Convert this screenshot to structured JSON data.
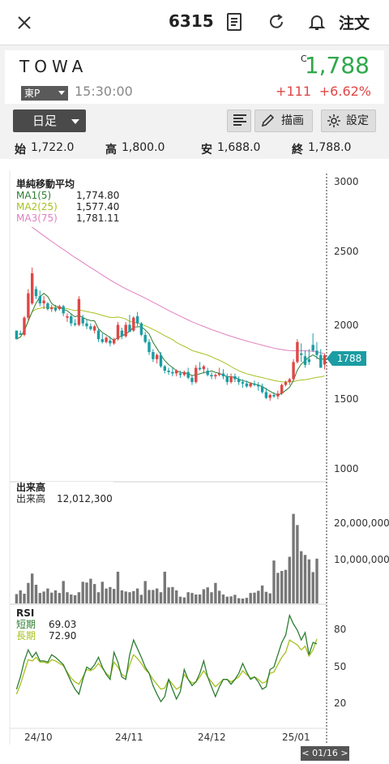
{
  "header": {
    "code": "6315",
    "order_label": "注文",
    "icons": [
      "close-icon",
      "memo-icon",
      "refresh-icon",
      "bell-icon"
    ]
  },
  "stock": {
    "name": "TOWA",
    "exchange": "東P",
    "time": "15:30:00",
    "c_flag": "C",
    "price": "1,788",
    "change": "+111",
    "change_pct": "+6.62%",
    "price_color": "#2ea84a",
    "change_color": "#e04646"
  },
  "controls": {
    "period": "日足",
    "draw_label": "描画",
    "settings_label": "設定"
  },
  "ohlc": {
    "open_label": "始",
    "open": "1,722.0",
    "high_label": "高",
    "high": "1,800.0",
    "low_label": "安",
    "low": "1,688.0",
    "close_label": "終",
    "close": "1,788.0"
  },
  "main_chart": {
    "title": "単純移動平均",
    "ma1_label": "MA1(5)",
    "ma1_value": "1,774.80",
    "ma1_color": "#2e7d32",
    "ma2_label": "MA2(25)",
    "ma2_value": "1,577.40",
    "ma2_color": "#a8c020",
    "ma3_label": "MA3(75)",
    "ma3_value": "1,781.11",
    "ma3_color": "#e080c0",
    "y_ticks": [
      "3000",
      "2500",
      "2000",
      "1500",
      "1000"
    ],
    "price_tag": "1788"
  },
  "volume_chart": {
    "title": "出来高",
    "label": "出来高",
    "value": "12,012,300",
    "y_ticks": [
      "20,000,000",
      "10,000,000"
    ]
  },
  "rsi_chart": {
    "title": "RSI",
    "short_label": "短期",
    "short_value": "69.03",
    "short_color": "#2e7d32",
    "long_label": "長期",
    "long_value": "72.90",
    "long_color": "#a8c020",
    "y_ticks": [
      "80",
      "50",
      "20"
    ]
  },
  "x_axis": {
    "labels": [
      "24/10",
      "24/11",
      "24/12",
      "25/01"
    ],
    "cursor_date": "< 01/16 >"
  },
  "chart_data": {
    "type": "candlestick",
    "up_color": "#e04646",
    "down_color": "#1a9da3",
    "ylim": [
      1000,
      3000
    ],
    "candles": [
      [
        1960,
        1960,
        1920,
        1900
      ],
      [
        1940,
        1960,
        1930,
        1930
      ],
      [
        1930,
        2060,
        1920,
        2050
      ],
      [
        2050,
        2250,
        2030,
        2220
      ],
      [
        2150,
        2400,
        2140,
        2360
      ],
      [
        2250,
        2270,
        2180,
        2200
      ],
      [
        2200,
        2240,
        2130,
        2150
      ],
      [
        2150,
        2200,
        2110,
        2170
      ],
      [
        2150,
        2160,
        2100,
        2110
      ],
      [
        2110,
        2140,
        2090,
        2120
      ],
      [
        2120,
        2140,
        2090,
        2100
      ],
      [
        2110,
        2140,
        2100,
        2130
      ],
      [
        2130,
        2140,
        2060,
        2080
      ],
      [
        2050,
        2080,
        2020,
        2060
      ],
      [
        2060,
        2080,
        1990,
        2010
      ],
      [
        2010,
        2040,
        1990,
        2000
      ],
      [
        2000,
        2200,
        1990,
        2180
      ],
      [
        2050,
        2070,
        1990,
        2010
      ],
      [
        2010,
        2040,
        1970,
        1990
      ],
      [
        1990,
        2010,
        1960,
        1970
      ],
      [
        1960,
        2000,
        1940,
        1990
      ],
      [
        1960,
        1970,
        1880,
        1900
      ],
      [
        1900,
        1940,
        1870,
        1880
      ],
      [
        1880,
        1920,
        1870,
        1910
      ],
      [
        1890,
        1920,
        1850,
        1870
      ],
      [
        1870,
        1910,
        1860,
        1900
      ],
      [
        1900,
        2020,
        1890,
        2000
      ],
      [
        1960,
        1980,
        1900,
        1920
      ],
      [
        1920,
        2020,
        1910,
        2000
      ],
      [
        2000,
        2070,
        1990,
        1950
      ],
      [
        1960,
        2060,
        1950,
        2050
      ],
      [
        2060,
        2090,
        1990,
        2010
      ],
      [
        2010,
        2020,
        1920,
        1930
      ],
      [
        1930,
        1950,
        1870,
        1880
      ],
      [
        1880,
        1900,
        1790,
        1810
      ],
      [
        1810,
        1830,
        1740,
        1760
      ],
      [
        1760,
        1800,
        1730,
        1790
      ],
      [
        1790,
        1810,
        1700,
        1710
      ],
      [
        1710,
        1720,
        1660,
        1680
      ],
      [
        1680,
        1700,
        1650,
        1670
      ],
      [
        1670,
        1700,
        1640,
        1660
      ],
      [
        1660,
        1690,
        1640,
        1680
      ],
      [
        1660,
        1680,
        1630,
        1650
      ],
      [
        1650,
        1680,
        1640,
        1670
      ],
      [
        1670,
        1700,
        1620,
        1630
      ],
      [
        1630,
        1650,
        1580,
        1600
      ],
      [
        1600,
        1720,
        1590,
        1700
      ],
      [
        1700,
        1740,
        1680,
        1690
      ],
      [
        1690,
        1720,
        1660,
        1710
      ],
      [
        1680,
        1700,
        1640,
        1650
      ],
      [
        1650,
        1670,
        1620,
        1640
      ],
      [
        1640,
        1660,
        1620,
        1650
      ],
      [
        1650,
        1700,
        1640,
        1660
      ],
      [
        1660,
        1690,
        1620,
        1640
      ],
      [
        1640,
        1660,
        1580,
        1600
      ],
      [
        1600,
        1660,
        1590,
        1640
      ],
      [
        1640,
        1660,
        1600,
        1620
      ],
      [
        1620,
        1640,
        1580,
        1600
      ],
      [
        1600,
        1620,
        1560,
        1590
      ],
      [
        1590,
        1610,
        1560,
        1570
      ],
      [
        1570,
        1600,
        1560,
        1590
      ],
      [
        1590,
        1610,
        1570,
        1580
      ],
      [
        1580,
        1600,
        1540,
        1570
      ],
      [
        1570,
        1590,
        1520,
        1530
      ],
      [
        1530,
        1560,
        1480,
        1490
      ],
      [
        1490,
        1520,
        1470,
        1510
      ],
      [
        1510,
        1530,
        1490,
        1500
      ],
      [
        1500,
        1540,
        1480,
        1520
      ],
      [
        1520,
        1590,
        1510,
        1580
      ],
      [
        1580,
        1610,
        1570,
        1600
      ],
      [
        1600,
        1630,
        1580,
        1620
      ],
      [
        1620,
        1760,
        1610,
        1740
      ],
      [
        1740,
        1900,
        1730,
        1880
      ],
      [
        1800,
        1870,
        1740,
        1790
      ],
      [
        1780,
        1820,
        1700,
        1720
      ],
      [
        1760,
        1830,
        1720,
        1740
      ],
      [
        1860,
        1940,
        1810,
        1820
      ],
      [
        1820,
        1880,
        1760,
        1790
      ],
      [
        1790,
        1830,
        1700,
        1700
      ],
      [
        1722,
        1800,
        1688,
        1788
      ]
    ],
    "volume_m": [
      2.5,
      3.5,
      2.6,
      5.5,
      8.0,
      5.0,
      2.8,
      3.2,
      4.0,
      2.9,
      3.5,
      2.8,
      6.0,
      3.0,
      2.4,
      2.2,
      3.0,
      5.8,
      5.6,
      6.6,
      5.2,
      3.0,
      5.8,
      4.0,
      4.4,
      3.9,
      8.5,
      3.5,
      3.2,
      3.0,
      3.3,
      4.0,
      2.3,
      6.0,
      3.6,
      3.6,
      4.0,
      3.0,
      8.5,
      4.3,
      4.4,
      3.5,
      1.8,
      1.6,
      3.0,
      2.8,
      2.4,
      2.4,
      3.8,
      4.3,
      3.0,
      5.5,
      3.4,
      2.4,
      1.8,
      1.9,
      2.3,
      1.4,
      1.3,
      1.5,
      2.8,
      2.9,
      3.4,
      4.8,
      3.1,
      2.7,
      11.5,
      8.2,
      8.7,
      9.0,
      12.5,
      24.0,
      21.0,
      14.0,
      13.0,
      11.8,
      8.4,
      12.0
    ],
    "rsi_short": [
      32,
      42,
      55,
      64,
      58,
      62,
      55,
      55,
      54,
      60,
      58,
      55,
      52,
      45,
      38,
      32,
      28,
      40,
      50,
      48,
      52,
      58,
      50,
      44,
      40,
      62,
      54,
      42,
      40,
      60,
      72,
      65,
      58,
      50,
      45,
      35,
      28,
      22,
      26,
      40,
      32,
      24,
      30,
      48,
      40,
      35,
      38,
      45,
      55,
      42,
      34,
      26,
      34,
      40,
      40,
      36,
      40,
      45,
      53,
      46,
      40,
      42,
      38,
      32,
      34,
      48,
      50,
      60,
      70,
      76,
      92,
      85,
      80,
      72,
      78,
      60,
      70,
      69
    ],
    "rsi_long": [
      28,
      36,
      46,
      56,
      55,
      58,
      54,
      54,
      53,
      56,
      55,
      53,
      51,
      46,
      41,
      38,
      36,
      42,
      48,
      47,
      49,
      53,
      49,
      45,
      42,
      54,
      50,
      44,
      42,
      52,
      60,
      57,
      53,
      48,
      45,
      40,
      36,
      32,
      33,
      40,
      36,
      32,
      34,
      44,
      40,
      37,
      38,
      42,
      47,
      42,
      38,
      34,
      37,
      40,
      40,
      38,
      40,
      42,
      47,
      44,
      41,
      42,
      40,
      37,
      38,
      45,
      46,
      52,
      58,
      62,
      72,
      70,
      68,
      64,
      67,
      59,
      64,
      72.9
    ]
  }
}
